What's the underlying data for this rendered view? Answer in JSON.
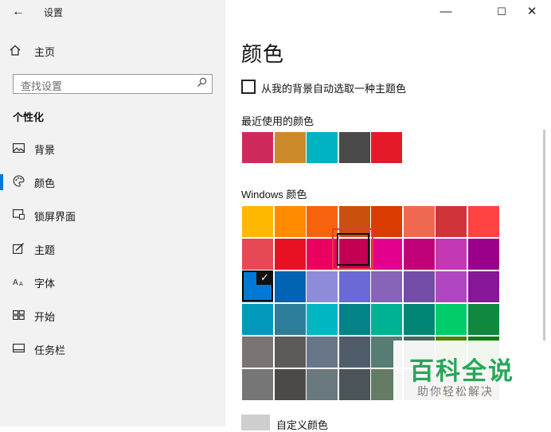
{
  "window": {
    "title": "设置",
    "back_icon": "arrow-left-icon",
    "controls": {
      "minimize": "—",
      "maximize": "☐",
      "close": "✕"
    }
  },
  "sidebar": {
    "home": {
      "label": "主页",
      "icon": "home-icon"
    },
    "search": {
      "placeholder": "查找设置",
      "icon": "search-icon"
    },
    "section_title": "个性化",
    "items": [
      {
        "label": "背景",
        "icon": "picture-icon",
        "selected": false
      },
      {
        "label": "颜色",
        "icon": "palette-icon",
        "selected": true
      },
      {
        "label": "锁屏界面",
        "icon": "lock-screen-icon",
        "selected": false
      },
      {
        "label": "主题",
        "icon": "theme-brush-icon",
        "selected": false
      },
      {
        "label": "字体",
        "icon": "font-icon",
        "selected": false
      },
      {
        "label": "开始",
        "icon": "start-grid-icon",
        "selected": false
      },
      {
        "label": "任务栏",
        "icon": "taskbar-icon",
        "selected": false
      }
    ],
    "accent_color": "#0078d7"
  },
  "main": {
    "title": "颜色",
    "auto_pick": {
      "label": "从我的背景自动选取一种主题色",
      "checked": false
    },
    "recent": {
      "label": "最近使用的颜色",
      "colors": [
        "#d02a5c",
        "#cc8a2a",
        "#00b3c2",
        "#4a4a4a",
        "#e51a28"
      ]
    },
    "windows_colors": {
      "label": "Windows 颜色",
      "rows": [
        [
          "#ffb900",
          "#ff8c00",
          "#f7630c",
          "#ca5010",
          "#da3b01",
          "#ef6950",
          "#d13438",
          "#ff4343"
        ],
        [
          "#e74856",
          "#e81123",
          "#ea005e",
          "#c30052",
          "#e3008c",
          "#bf0077",
          "#c239b3",
          "#9a0089"
        ],
        [
          "#0078d7",
          "#0063b1",
          "#8e8cd8",
          "#6b69d6",
          "#8764b8",
          "#744da9",
          "#b146c2",
          "#881798"
        ],
        [
          "#0099bc",
          "#2d7d9a",
          "#00b7c3",
          "#038387",
          "#00b294",
          "#018574",
          "#00cc6a",
          "#10893e"
        ],
        [
          "#7a7574",
          "#5d5a58",
          "#68768a",
          "#515c6b",
          "#567c73",
          "#486860",
          "#498205",
          "#107c10"
        ],
        [
          "#767676",
          "#4c4a48",
          "#69797e",
          "#4a5459",
          "#647c64",
          "#525e54",
          "#847545",
          "#7e735f"
        ]
      ],
      "current": "#0078d7",
      "highlighted": "#c30052",
      "check_glyph": "✓"
    },
    "custom": {
      "label": "自定义颜色",
      "swatch_color": "#cfcfcf"
    }
  },
  "watermark": {
    "title": "百科全说",
    "subtitle": "助你轻松解决",
    "color": "#27a65a"
  }
}
